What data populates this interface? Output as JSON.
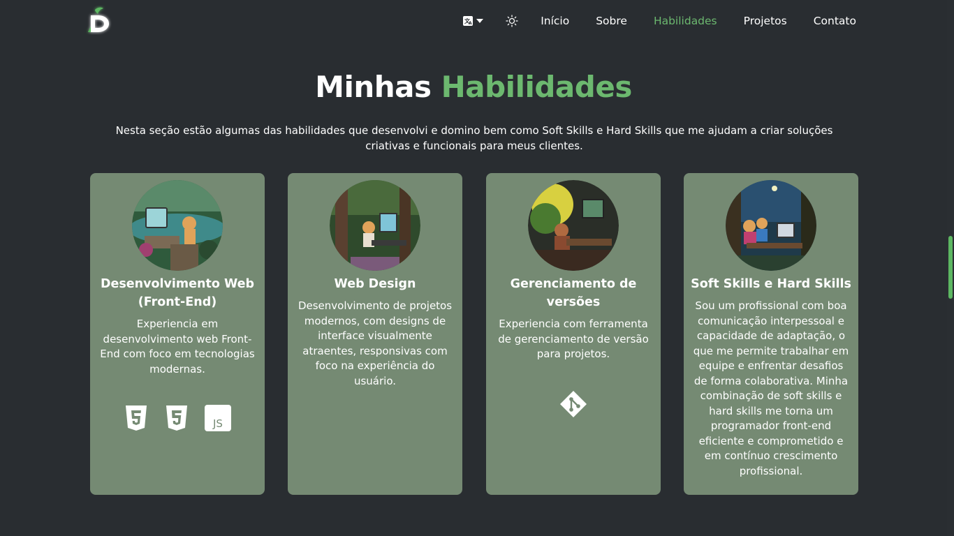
{
  "header": {
    "logo_alt": "D",
    "nav": [
      {
        "label": "Início"
      },
      {
        "label": "Sobre"
      },
      {
        "label": "Habilidades"
      },
      {
        "label": "Projetos"
      },
      {
        "label": "Contato"
      }
    ],
    "language_icon": "translate-icon",
    "theme_icon": "sun-icon"
  },
  "section": {
    "title_part1": "Minhas",
    "title_part2": "Habilidades",
    "description": "Nesta seção estão algumas das habilidades que desenvolvi e domino bem como Soft Skills e Hard Skills que me ajudam a criar soluções criativas e funcionais para meus clientes."
  },
  "cards": [
    {
      "title": "Desenvolvimento Web (Front-End)",
      "text": "Experiencia em desenvolvimento web Front-End com foco em tecnologias modernas.",
      "icons": [
        "html5-icon",
        "css3-icon",
        "javascript-icon"
      ],
      "icon_labels": {
        "js": "JS"
      }
    },
    {
      "title": "Web Design",
      "text": "Desenvolvimento de projetos modernos, com designs de interface visualmente atraentes, responsivas com foco na experiência do usuário."
    },
    {
      "title": "Gerenciamento de versões",
      "text": "Experiencia com ferramenta de gerenciamento de versão para projetos.",
      "icons": [
        "git-icon"
      ]
    },
    {
      "title": "Soft Skills e Hard Skills",
      "text": "Sou um profissional com boa comunicação interpessoal e capacidade de adaptação, o que me permite trabalhar em equipe e enfrentar desafios de forma colaborativa. Minha combinação de soft skills e hard skills me torna um programador front-end eficiente e comprometido e em contínuo crescimento profissional."
    }
  ],
  "colors": {
    "background": "#292d31",
    "accent": "#6cb86f",
    "card": "#758a73"
  }
}
